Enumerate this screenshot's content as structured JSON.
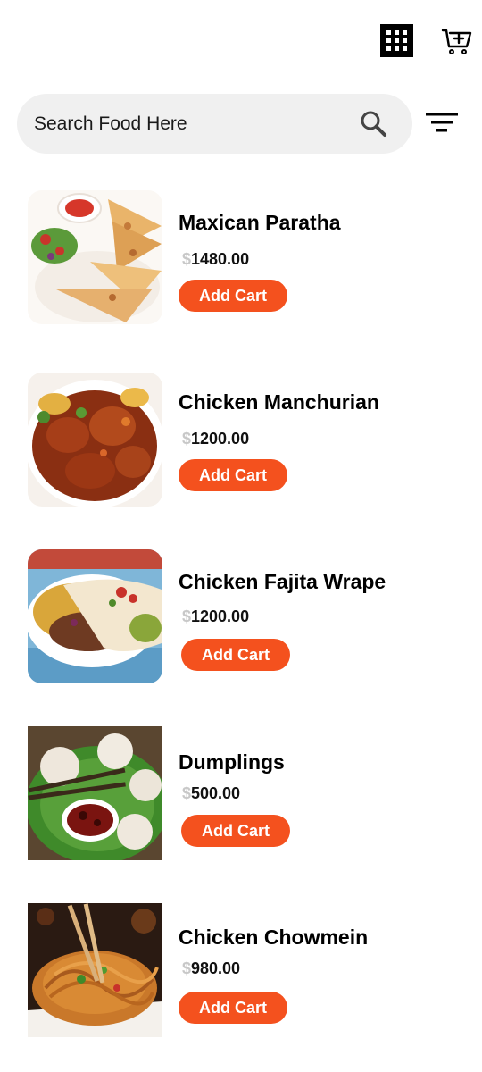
{
  "header": {
    "grid_icon": "grid-icon",
    "cart_icon": "cart-add-icon"
  },
  "search": {
    "placeholder": "Search Food Here",
    "search_icon": "search-icon",
    "filter_icon": "filter-icon"
  },
  "colors": {
    "accent": "#f4511e",
    "search_background": "#f0f0f0",
    "currency_symbol": "#c8c8c8"
  },
  "foods": [
    {
      "name": "Maxican Paratha",
      "currency": "$",
      "price": "1480.00",
      "button": "Add Cart"
    },
    {
      "name": "Chicken Manchurian",
      "currency": "$",
      "price": "1200.00",
      "button": "Add Cart"
    },
    {
      "name": "Chicken Fajita Wrape",
      "currency": "$",
      "price": "1200.00",
      "button": "Add Cart"
    },
    {
      "name": "Dumplings",
      "currency": "$",
      "price": "500.00",
      "button": "Add Cart"
    },
    {
      "name": "Chicken Chowmein",
      "currency": "$",
      "price": "980.00",
      "button": "Add Cart"
    }
  ]
}
